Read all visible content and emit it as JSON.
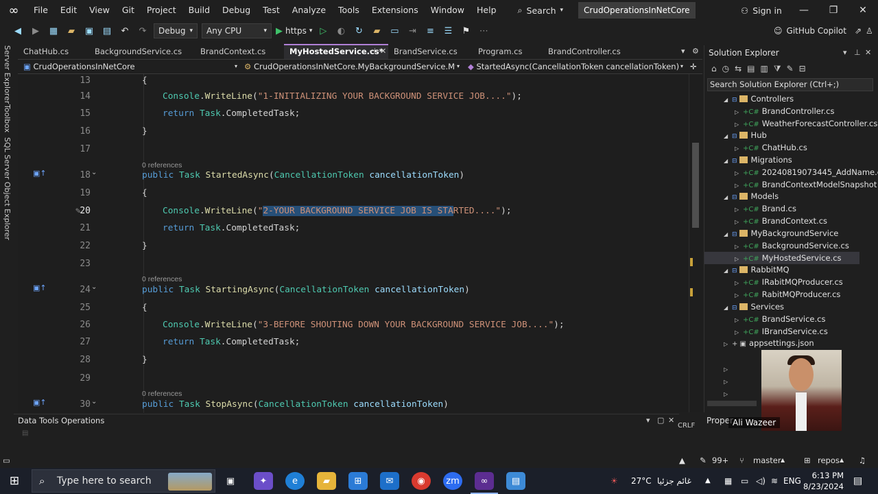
{
  "titlebar": {
    "menu": [
      "File",
      "Edit",
      "View",
      "Git",
      "Project",
      "Build",
      "Debug",
      "Test",
      "Analyze",
      "Tools",
      "Extensions",
      "Window",
      "Help"
    ],
    "search_label": "Search",
    "solution_name": "CrudOperationsInNetCore",
    "signin_label": "Sign in"
  },
  "toolbar": {
    "configuration": "Debug",
    "platform": "Any CPU",
    "run_profile": "https",
    "copilot_label": "GitHub Copilot"
  },
  "left_strip": [
    "Server Explorer",
    "Toolbox",
    "SQL Server Object Explorer"
  ],
  "tabs": [
    {
      "label": "ChatHub.cs",
      "active": false
    },
    {
      "label": "BackgroundService.cs",
      "active": false
    },
    {
      "label": "BrandContext.cs",
      "active": false
    },
    {
      "label": "MyHostedService.cs*",
      "active": true
    },
    {
      "label": "BrandService.cs",
      "active": false
    },
    {
      "label": "Program.cs",
      "active": false
    },
    {
      "label": "BrandController.cs",
      "active": false
    }
  ],
  "navbar": {
    "project": "CrudOperationsInNetCore",
    "type": "CrudOperationsInNetCore.MyBackgroundService.MyHoste",
    "member": "StartedAsync(CancellationToken cancellationToken)"
  },
  "editor": {
    "references_label": "0 references",
    "line_numbers": [
      "13",
      "14",
      "15",
      "16",
      "17",
      "18",
      "19",
      "20",
      "21",
      "22",
      "23",
      "24",
      "25",
      "26",
      "27",
      "28",
      "29",
      "30"
    ],
    "strings": {
      "s14": "\"1-INITIALIZING YOUR BACKGROUND SERVICE JOB....\"",
      "s20_sel": "2-YOUR BACKGROUND SERVICE JOB IS STA",
      "s20_rest": "RTED....\"",
      "s26": "\"3-BEFORE SHOUTING DOWN YOUR BACKGROUND SERVICE JOB....\""
    },
    "methods": {
      "m18": "StartedAsync",
      "m24": "StartingAsync",
      "m30": "StopAsync"
    }
  },
  "solution_explorer": {
    "title": "Solution Explorer",
    "search_placeholder": "Search Solution Explorer (Ctrl+;)",
    "items": [
      {
        "label": "Controllers",
        "kind": "folder",
        "depth": 1,
        "selected": false
      },
      {
        "label": "BrandController.cs",
        "kind": "cs",
        "depth": 2,
        "selected": false
      },
      {
        "label": "WeatherForecastController.cs",
        "kind": "cs",
        "depth": 2,
        "selected": false
      },
      {
        "label": "Hub",
        "kind": "folder",
        "depth": 1,
        "selected": false
      },
      {
        "label": "ChatHub.cs",
        "kind": "cs",
        "depth": 2,
        "selected": false
      },
      {
        "label": "Migrations",
        "kind": "folder",
        "depth": 1,
        "selected": false
      },
      {
        "label": "20240819073445_AddName.cs",
        "kind": "cs",
        "depth": 2,
        "selected": false
      },
      {
        "label": "BrandContextModelSnapshot",
        "kind": "cs",
        "depth": 2,
        "selected": false
      },
      {
        "label": "Models",
        "kind": "folder",
        "depth": 1,
        "selected": false
      },
      {
        "label": "Brand.cs",
        "kind": "cs",
        "depth": 2,
        "selected": false
      },
      {
        "label": "BrandContext.cs",
        "kind": "cs",
        "depth": 2,
        "selected": false
      },
      {
        "label": "MyBackgroundService",
        "kind": "folder",
        "depth": 1,
        "selected": false
      },
      {
        "label": "BackgroundService.cs",
        "kind": "cs",
        "depth": 2,
        "selected": false
      },
      {
        "label": "MyHostedService.cs",
        "kind": "cs",
        "depth": 2,
        "selected": true
      },
      {
        "label": "RabbitMQ",
        "kind": "folder",
        "depth": 1,
        "selected": false
      },
      {
        "label": "IRabitMQProducer.cs",
        "kind": "cs",
        "depth": 2,
        "selected": false
      },
      {
        "label": "RabitMQProducer.cs",
        "kind": "cs",
        "depth": 2,
        "selected": false
      },
      {
        "label": "Services",
        "kind": "folder",
        "depth": 1,
        "selected": false
      },
      {
        "label": "BrandService.cs",
        "kind": "cs",
        "depth": 2,
        "selected": false
      },
      {
        "label": "IBrandService.cs",
        "kind": "cs",
        "depth": 2,
        "selected": false
      },
      {
        "label": "appsettings.json",
        "kind": "json",
        "depth": 1,
        "selected": false
      }
    ],
    "properties_label": "Proper",
    "presenter_name": "Ali Wazeer"
  },
  "bottom_panel": {
    "title": "Data Tools Operations",
    "line_ending": "CRLF"
  },
  "statusbar": {
    "notifications": "99+",
    "branch": "master",
    "repos": "repos"
  },
  "taskbar": {
    "search_placeholder": "Type here to search",
    "weather": "27°C",
    "weather_desc": "غائم جزئيا",
    "language": "ENG",
    "time": "6:13 PM",
    "date": "8/23/2024"
  }
}
